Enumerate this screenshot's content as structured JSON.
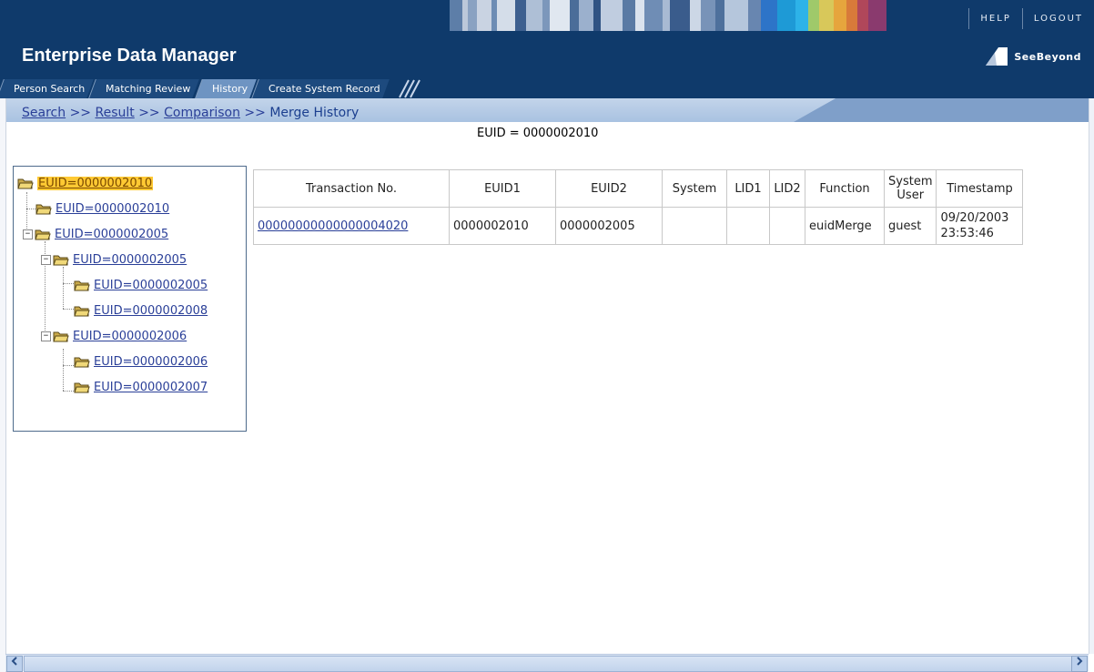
{
  "app": {
    "title": "Enterprise Data Manager",
    "logo_text": "SeeBeyond"
  },
  "top_links": {
    "help": "HELP",
    "logout": "LOGOUT"
  },
  "tabs": [
    {
      "label": "Person Search",
      "active": false
    },
    {
      "label": "Matching Review",
      "active": false
    },
    {
      "label": "History",
      "active": true
    },
    {
      "label": "Create System Record",
      "active": false
    }
  ],
  "breadcrumb": {
    "items": [
      "Search",
      "Result",
      "Comparison"
    ],
    "current": "Merge History",
    "separator": ">>"
  },
  "heading": "EUID = 0000002010",
  "tree": [
    {
      "label": "EUID=0000002010",
      "selected": true,
      "level": 0
    },
    {
      "label": "EUID=0000002010",
      "selected": false,
      "level": 1
    },
    {
      "label": "EUID=0000002005",
      "selected": false,
      "level": 1,
      "expander": "−"
    },
    {
      "label": "EUID=0000002005",
      "selected": false,
      "level": 2,
      "expander": "−"
    },
    {
      "label": "EUID=0000002005",
      "selected": false,
      "level": 3
    },
    {
      "label": "EUID=0000002008",
      "selected": false,
      "level": 3
    },
    {
      "label": "EUID=0000002006",
      "selected": false,
      "level": 2,
      "expander": "−"
    },
    {
      "label": "EUID=0000002006",
      "selected": false,
      "level": 3
    },
    {
      "label": "EUID=0000002007",
      "selected": false,
      "level": 3
    }
  ],
  "table": {
    "columns": [
      "Transaction No.",
      "EUID1",
      "EUID2",
      "System",
      "LID1",
      "LID2",
      "Function",
      "System User",
      "Timestamp"
    ],
    "rows": [
      {
        "transaction_no": "00000000000000004020",
        "euid1": "0000002010",
        "euid2": "0000002005",
        "system": "",
        "lid1": "",
        "lid2": "",
        "function": "euidMerge",
        "system_user": "guest",
        "timestamp": "09/20/2003 23:53:46"
      }
    ]
  },
  "colors": {
    "header": "#0f3a6b",
    "active_tab": "#6e94c2",
    "link": "#2a3f98",
    "selected_node": "#ffc933"
  }
}
